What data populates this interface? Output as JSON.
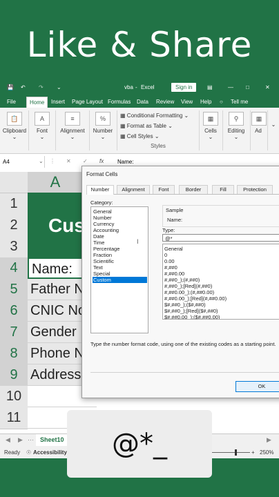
{
  "banner": {
    "title": "Like & Share"
  },
  "titlebar": {
    "file_name": "vba",
    "separator": "-",
    "app_name": "Excel",
    "signin_label": "Sign in"
  },
  "menu": [
    "File",
    "Home",
    "Insert",
    "Page Layout",
    "Formulas",
    "Data",
    "Review",
    "View",
    "Help",
    "Tell me"
  ],
  "ribbon": {
    "clipboard": "Clipboard",
    "font": "Font",
    "alignment": "Alignment",
    "number": "Number",
    "number_symbol": "%",
    "conditional": "Conditional Formatting",
    "format_table": "Format as Table",
    "cell_styles": "Cell Styles",
    "styles_group": "Styles",
    "cells": "Cells",
    "editing": "Editing",
    "extra": "Ad"
  },
  "namebox": {
    "value": "A4",
    "formula_prefix": "fx",
    "formula_value": "Name:"
  },
  "grid": {
    "column_label": "A",
    "rows": [
      "1",
      "2",
      "3",
      "4",
      "5",
      "6",
      "7",
      "8",
      "9",
      "10",
      "11"
    ],
    "title_cell": "Cus",
    "cells": [
      "Name:",
      "Father N",
      "CNIC No",
      "Gender",
      "Phone N",
      "Address"
    ]
  },
  "sheetbar": {
    "tab": "Sheet10"
  },
  "statusbar": {
    "ready": "Ready",
    "accessibility": "Accessibility: In",
    "zoom": "250%"
  },
  "dialog": {
    "title": "Format Cells",
    "tabs": [
      "Number",
      "Alignment",
      "Font",
      "Border",
      "Fill",
      "Protection"
    ],
    "category_label": "Category:",
    "categories": [
      "General",
      "Number",
      "Currency",
      "Accounting",
      "Date",
      "Time",
      "Percentage",
      "Fraction",
      "Scientific",
      "Text",
      "Special",
      "Custom"
    ],
    "sample_label": "Sample",
    "sample_value": "Name:",
    "type_label": "Type:",
    "type_value": "@*",
    "formats": [
      "General",
      "0",
      "0.00",
      "#,##0",
      "#,##0.00",
      "#,##0_);(#,##0)",
      "#,##0_);[Red](#,##0)",
      "#,##0.00_);(#,##0.00)",
      "#,##0.00_);[Red](#,##0.00)",
      "$#,##0_);($#,##0)",
      "$#,##0_);[Red]($#,##0)",
      "$#,##0.00_);($#,##0.00)"
    ],
    "description": "Type the number format code, using one of the existing codes as a starting point.",
    "ok_label": "OK"
  },
  "overlay": {
    "text": "@*_"
  }
}
